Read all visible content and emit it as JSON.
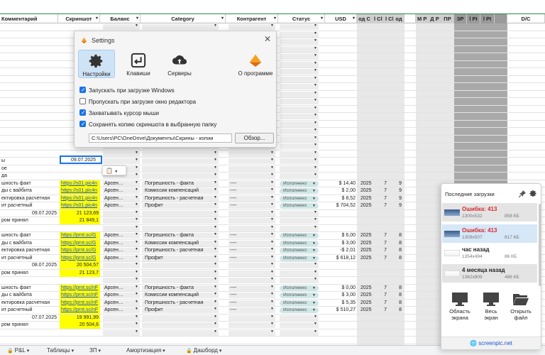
{
  "sheet": {
    "headers": [
      "Комментарий",
      "Скриншот",
      "Баланс",
      "Category",
      "Контрагент",
      "Статус",
      "USD",
      "од С",
      "l Cl",
      "l Cl",
      "од",
      "М Р",
      "Д Р",
      "ПР",
      "ЗР",
      "l PI",
      "l PI",
      "D/C"
    ],
    "side_rows": [
      {
        "label": "ы",
        "row": 18
      },
      {
        "label": "ое",
        "row": 19
      },
      {
        "label": "да",
        "row": 20
      },
      {
        "label": "шность факт",
        "row": 21
      },
      {
        "label": "ды с вайбита",
        "row": 22
      },
      {
        "label": "ектировка расчетная",
        "row": 23
      },
      {
        "label": "ит расчетный",
        "row": 24
      },
      {
        "label": "09.07.2025",
        "row": 25,
        "right": true
      },
      {
        "label": "ром принял",
        "row": 26
      },
      {
        "label": "шность факт",
        "row": 28
      },
      {
        "label": "ды с вайбита",
        "row": 29
      },
      {
        "label": "ектировка расчетная",
        "row": 30
      },
      {
        "label": "ит расчетный",
        "row": 31
      },
      {
        "label": "08.07.2025",
        "row": 32,
        "right": true
      },
      {
        "label": "ром принял",
        "row": 33
      },
      {
        "label": "шность факт",
        "row": 35
      },
      {
        "label": "ды с вайбита",
        "row": 36
      },
      {
        "label": "ектировка расчетная",
        "row": 37
      },
      {
        "label": "ит расчетный",
        "row": 38
      },
      {
        "label": "07.07.2025",
        "row": 39,
        "right": true
      },
      {
        "label": "ром принял",
        "row": 40
      }
    ],
    "selected_date": "09.07.2025",
    "data_rows": [
      {
        "row": 21,
        "link": "https://s01.pic4n",
        "bal": "Арсен…",
        "cat": "Погрешность - факта",
        "kontr": "----",
        "status": "Исполнено",
        "usd": "$   14,40",
        "year": "2025",
        "a": "7",
        "b": "9"
      },
      {
        "row": 22,
        "link": "https://s01.pic4n",
        "bal": "Арсен…",
        "cat": "Комиссии компенсаций",
        "kontr": "----",
        "status": "Исполнено",
        "usd": "$    2,00",
        "year": "2025",
        "a": "7",
        "b": "9"
      },
      {
        "row": 23,
        "link": "https://s01.pic4n",
        "bal": "Арсен…",
        "cat": "Погрешность - расчетная",
        "kontr": "----",
        "status": "Исполнено",
        "usd": "$    8,52",
        "year": "2025",
        "a": "7",
        "b": "9"
      },
      {
        "row": 24,
        "link": "https://s01.pic4n",
        "bal": "Арсен…",
        "cat": "Профит",
        "kontr": "----",
        "status": "Исполнено",
        "usd": "$  704,52",
        "year": "2025",
        "a": "7",
        "b": "9"
      },
      {
        "row": 28,
        "link": "https://prnt.sc/G",
        "bal": "Арсен…",
        "cat": "Погрешность - факта",
        "kontr": "----",
        "status": "Исполнено",
        "usd": "$    6,00",
        "year": "2025",
        "a": "7",
        "b": "8"
      },
      {
        "row": 29,
        "link": "https://prnt.sc/G",
        "bal": "Арсен…",
        "cat": "Комиссии компенсаций",
        "kontr": "----",
        "status": "Исполнено",
        "usd": "$    3,00",
        "year": "2025",
        "a": "7",
        "b": "8"
      },
      {
        "row": 30,
        "link": "https://prnt.sc/G",
        "bal": "Арсен…",
        "cat": "Погрешность - расчетная",
        "kontr": "----",
        "status": "Исполнено",
        "usd": "-$   2,01",
        "year": "2025",
        "a": "7",
        "b": "8"
      },
      {
        "row": 31,
        "link": "https://prnt.sc/G",
        "bal": "Арсен…",
        "cat": "Профит",
        "kontr": "----",
        "status": "Исполнено",
        "usd": "$  618,12",
        "year": "2025",
        "a": "7",
        "b": "8"
      },
      {
        "row": 35,
        "link": "https://prnt.sc/nF",
        "bal": "Арсен…",
        "cat": "Погрешность - факта",
        "kontr": "----",
        "status": "Исполнено",
        "usd": "$    0,00",
        "year": "2025",
        "a": "7",
        "b": "8"
      },
      {
        "row": 36,
        "link": "https://prnt.sc/nF",
        "bal": "Арсен…",
        "cat": "Комиссии компенсаций",
        "kontr": "----",
        "status": "Исполнено",
        "usd": "$    3,00",
        "year": "2025",
        "a": "7",
        "b": "8"
      },
      {
        "row": 37,
        "link": "https://prnt.sc/nF",
        "bal": "Арсен…",
        "cat": "Погрешность - расчетная",
        "kontr": "----",
        "status": "Исполнено",
        "usd": "$    5,35",
        "year": "2025",
        "a": "7",
        "b": "8"
      },
      {
        "row": 38,
        "link": "https://prnt.sc/nF",
        "bal": "Арсен…",
        "cat": "Профит",
        "kontr": "----",
        "status": "Исполнено",
        "usd": "$  510,27",
        "year": "2025",
        "a": "7",
        "b": "8"
      }
    ],
    "yellow_totals": [
      {
        "row": 25,
        "value": "21 123,69"
      },
      {
        "row": 26,
        "value": "21 849,1"
      },
      {
        "row": 32,
        "value": "20 504,57"
      },
      {
        "row": 33,
        "value": "21 123,7"
      },
      {
        "row": 39,
        "value": "19 991,99"
      },
      {
        "row": 40,
        "value": "20 504,6"
      }
    ]
  },
  "tabs": [
    {
      "label": "P&L",
      "lock": true
    },
    {
      "label": "Таблицы",
      "lock": false
    },
    {
      "label": "ЗП",
      "lock": false
    },
    {
      "label": "Амортизация",
      "lock": false
    },
    {
      "label": "Дашборд",
      "lock": true
    }
  ],
  "settings": {
    "title": "Settings",
    "tabs": [
      {
        "label": "Настройки",
        "icon": "gear-icon",
        "active": true
      },
      {
        "label": "Клавиши",
        "icon": "keyboard-icon",
        "active": false
      },
      {
        "label": "Серверы",
        "icon": "cloud-upload-icon",
        "active": false
      },
      {
        "label": "О программе",
        "icon": "app-logo-icon",
        "active": false
      }
    ],
    "options": [
      {
        "label": "Запускать при загрузке Windows",
        "checked": true
      },
      {
        "label": "Пропускать при загрузке окно редактора",
        "checked": false
      },
      {
        "label": "Захватывать курсор мыши",
        "checked": true
      },
      {
        "label": "Сохранять копию скриншота в выбранную папку",
        "checked": true
      }
    ],
    "path": "C:\\Users\\PC\\OneDrive\\Документы\\Скрины - копии",
    "browse_label": "Обзор..."
  },
  "uploads": {
    "title": "Последние загрузки",
    "items": [
      {
        "title": "Ошибка: 413",
        "dims": "1300x532",
        "size": "858 КБ",
        "error": true,
        "style": "g"
      },
      {
        "title": "Ошибка: 413",
        "dims": "1309x507",
        "size": "817 КБ",
        "error": true,
        "style": "hl"
      },
      {
        "title": "час назад",
        "dims": "1354x494",
        "size": "86 КБ",
        "error": false,
        "style": ""
      },
      {
        "title": "4 месяца назад",
        "dims": "1362x809",
        "size": "486 КБ",
        "error": false,
        "style": "g"
      }
    ],
    "actions": [
      {
        "label1": "Область",
        "label2": "экрана"
      },
      {
        "label1": "Весь",
        "label2": "экран"
      },
      {
        "label1": "Открыть",
        "label2": "файл"
      }
    ],
    "footer": "screenpic.net"
  }
}
